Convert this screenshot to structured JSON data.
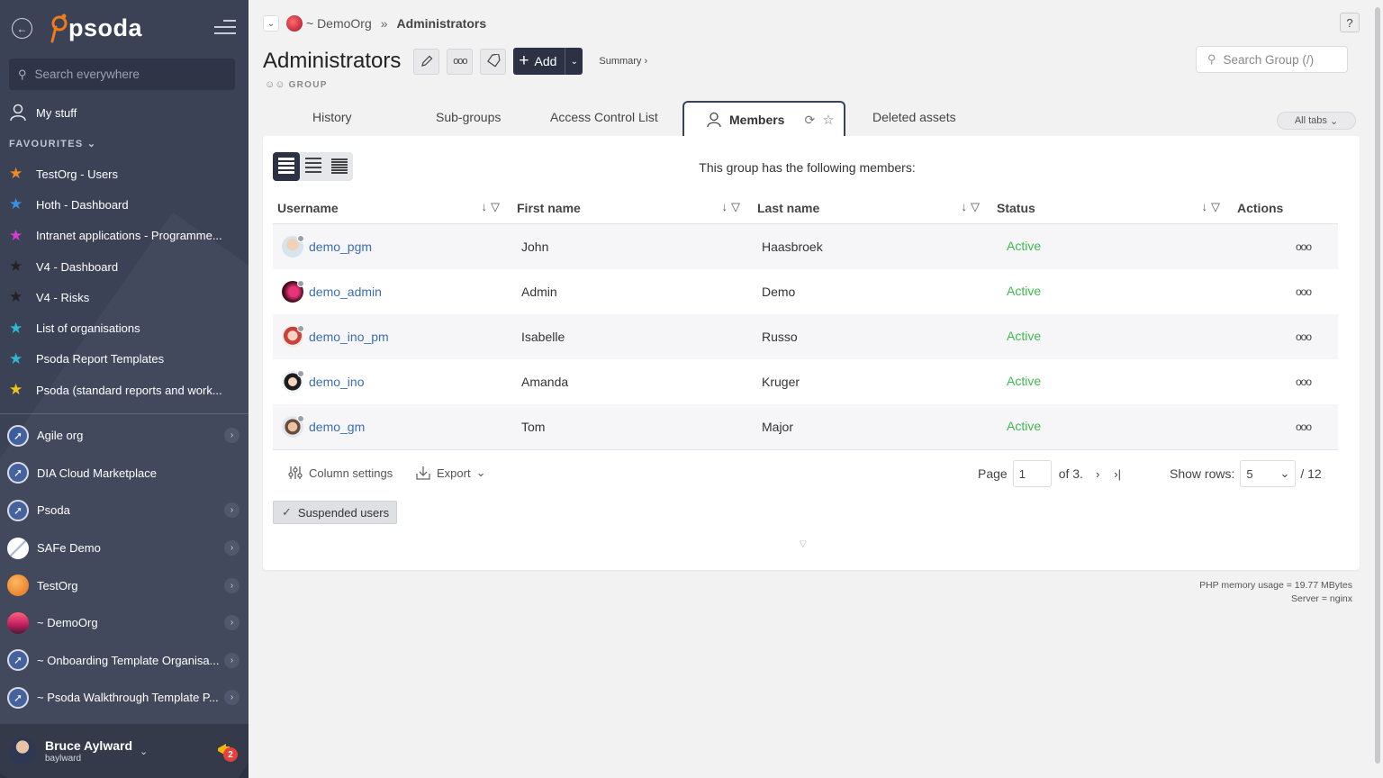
{
  "sidebar": {
    "logo_text": "psoda",
    "search_placeholder": "Search everywhere",
    "my_stuff": "My stuff",
    "favourites_title": "FAVOURITES",
    "favourites": [
      {
        "label": "TestOrg - Users",
        "color": "#f08a24"
      },
      {
        "label": "Hoth - Dashboard",
        "color": "#3b8fe0"
      },
      {
        "label": "Intranet applications - Programme...",
        "color": "#d83bd2"
      },
      {
        "label": "V4 - Dashboard",
        "color": "#222222"
      },
      {
        "label": "V4 - Risks",
        "color": "#222222"
      },
      {
        "label": "List of organisations",
        "color": "#2fb8d6"
      },
      {
        "label": "Psoda Report Templates",
        "color": "#2fb8d6"
      },
      {
        "label": "Psoda (standard reports and work...",
        "color": "#f0c419"
      }
    ],
    "orgs": [
      {
        "label": "Agile org",
        "icon": "compass-icon",
        "chevron": true
      },
      {
        "label": "DIA Cloud Marketplace",
        "icon": "compass-icon",
        "chevron": false
      },
      {
        "label": "Psoda",
        "icon": "compass-icon",
        "chevron": true
      },
      {
        "label": "SAFe Demo",
        "icon": "safe-logo-icon",
        "chevron": true
      },
      {
        "label": "TestOrg",
        "icon": "orange-circle-icon",
        "chevron": true
      },
      {
        "label": "~ DemoOrg",
        "icon": "sunset-circle-icon",
        "chevron": true
      },
      {
        "label": "~ Onboarding Template Organisa...",
        "icon": "compass-icon",
        "chevron": true
      },
      {
        "label": "~ Psoda Walkthrough Template P...",
        "icon": "compass-icon",
        "chevron": true
      }
    ],
    "user": {
      "name": "Bruce Aylward",
      "login": "baylward",
      "notifications": "2"
    }
  },
  "breadcrumb": {
    "org": "~ DemoOrg",
    "separator": "»",
    "current": "Administrators"
  },
  "header": {
    "title": "Administrators",
    "type_label": "GROUP",
    "add_label": "Add",
    "summary_label": "Summary ›",
    "search_placeholder": "Search Group (/)",
    "help": "?"
  },
  "tabs": {
    "history": "History",
    "subgroups": "Sub-groups",
    "acl": "Access Control List",
    "members": "Members",
    "deleted": "Deleted assets",
    "all_tabs": "All tabs"
  },
  "members": {
    "intro": "This group has the following members:",
    "columns": {
      "username": "Username",
      "first_name": "First name",
      "last_name": "Last name",
      "status": "Status",
      "actions": "Actions"
    },
    "rows": [
      {
        "username": "demo_pgm",
        "first": "John",
        "last": "Haasbroek",
        "status": "Active",
        "actions": "ooo"
      },
      {
        "username": "demo_admin",
        "first": "Admin",
        "last": "Demo",
        "status": "Active",
        "actions": "ooo"
      },
      {
        "username": "demo_ino_pm",
        "first": "Isabelle",
        "last": "Russo",
        "status": "Active",
        "actions": "ooo"
      },
      {
        "username": "demo_ino",
        "first": "Amanda",
        "last": "Kruger",
        "status": "Active",
        "actions": "ooo"
      },
      {
        "username": "demo_gm",
        "first": "Tom",
        "last": "Major",
        "status": "Active",
        "actions": "ooo"
      }
    ],
    "column_settings": "Column settings",
    "export": "Export",
    "page_label": "Page",
    "page_value": "1",
    "page_of": "of 3.",
    "show_rows_label": "Show rows:",
    "rows_value": "5",
    "total": "/ 12",
    "suspended_label": "Suspended users"
  },
  "footer": {
    "memory": "PHP memory usage = 19.77 MBytes",
    "server": "Server = nginx"
  }
}
